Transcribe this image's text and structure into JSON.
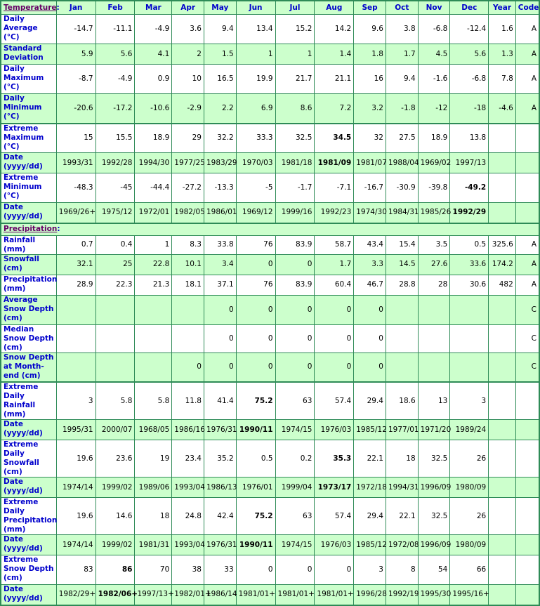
{
  "header": {
    "section_label": "Temperature",
    "columns": [
      "Jan",
      "Feb",
      "Mar",
      "Apr",
      "May",
      "Jun",
      "Jul",
      "Aug",
      "Sep",
      "Oct",
      "Nov",
      "Dec",
      "Year",
      "Code"
    ]
  },
  "temperature": {
    "rows": [
      {
        "label": "Daily Average (°C)",
        "values": [
          "-14.7",
          "-11.1",
          "-4.9",
          "3.6",
          "9.4",
          "13.4",
          "15.2",
          "14.2",
          "9.6",
          "3.8",
          "-6.8",
          "-12.4",
          "1.6",
          "A"
        ],
        "bold": []
      },
      {
        "label": "Standard Deviation",
        "values": [
          "5.9",
          "5.6",
          "4.1",
          "2",
          "1.5",
          "1",
          "1",
          "1.4",
          "1.8",
          "1.7",
          "4.5",
          "5.6",
          "1.3",
          "A"
        ],
        "bold": []
      },
      {
        "label": "Daily Maximum (°C)",
        "values": [
          "-8.7",
          "-4.9",
          "0.9",
          "10",
          "16.5",
          "19.9",
          "21.7",
          "21.1",
          "16",
          "9.4",
          "-1.6",
          "-6.8",
          "7.8",
          "A"
        ],
        "bold": []
      },
      {
        "label": "Daily Minimum (°C)",
        "values": [
          "-20.6",
          "-17.2",
          "-10.6",
          "-2.9",
          "2.2",
          "6.9",
          "8.6",
          "7.2",
          "3.2",
          "-1.8",
          "-12",
          "-18",
          "-4.6",
          "A"
        ],
        "bold": []
      },
      {
        "label": "Extreme Maximum (°C)",
        "values": [
          "15",
          "15.5",
          "18.9",
          "29",
          "32.2",
          "33.3",
          "32.5",
          "34.5",
          "32",
          "27.5",
          "18.9",
          "13.8",
          "",
          ""
        ],
        "bold": [
          7
        ]
      },
      {
        "label": "Date (yyyy/dd)",
        "values": [
          "1993/31",
          "1992/28",
          "1994/30",
          "1977/25",
          "1983/29",
          "1970/03",
          "1981/18",
          "1981/09",
          "1981/07",
          "1988/04",
          "1969/02",
          "1997/13",
          "",
          ""
        ],
        "bold": [
          7
        ]
      },
      {
        "label": "Extreme Minimum (°C)",
        "values": [
          "-48.3",
          "-45",
          "-44.4",
          "-27.2",
          "-13.3",
          "-5",
          "-1.7",
          "-7.1",
          "-16.7",
          "-30.9",
          "-39.8",
          "-49.2",
          "",
          ""
        ],
        "bold": [
          11
        ]
      },
      {
        "label": "Date (yyyy/dd)",
        "values": [
          "1969/26+",
          "1975/12",
          "1972/01",
          "1982/05",
          "1986/01",
          "1969/12",
          "1999/16",
          "1992/23",
          "1974/30",
          "1984/31",
          "1985/26",
          "1992/29",
          "",
          ""
        ],
        "bold": [
          11
        ]
      }
    ]
  },
  "precipitation": {
    "section_label": "Precipitation",
    "rows": [
      {
        "label": "Rainfall (mm)",
        "values": [
          "0.7",
          "0.4",
          "1",
          "8.3",
          "33.8",
          "76",
          "83.9",
          "58.7",
          "43.4",
          "15.4",
          "3.5",
          "0.5",
          "325.6",
          "A"
        ],
        "bold": []
      },
      {
        "label": "Snowfall (cm)",
        "values": [
          "32.1",
          "25",
          "22.8",
          "10.1",
          "3.4",
          "0",
          "0",
          "1.7",
          "3.3",
          "14.5",
          "27.6",
          "33.6",
          "174.2",
          "A"
        ],
        "bold": []
      },
      {
        "label": "Precipitation (mm)",
        "values": [
          "28.9",
          "22.3",
          "21.3",
          "18.1",
          "37.1",
          "76",
          "83.9",
          "60.4",
          "46.7",
          "28.8",
          "28",
          "30.6",
          "482",
          "A"
        ],
        "bold": []
      },
      {
        "label": "Average Snow Depth (cm)",
        "values": [
          "",
          "",
          "",
          "",
          "0",
          "0",
          "0",
          "0",
          "0",
          "",
          "",
          "",
          "",
          "C"
        ],
        "bold": []
      },
      {
        "label": "Median Snow Depth (cm)",
        "values": [
          "",
          "",
          "",
          "",
          "0",
          "0",
          "0",
          "0",
          "0",
          "",
          "",
          "",
          "",
          "C"
        ],
        "bold": []
      },
      {
        "label": "Snow Depth at Month-end (cm)",
        "values": [
          "",
          "",
          "",
          "0",
          "0",
          "0",
          "0",
          "0",
          "0",
          "",
          "",
          "",
          "",
          "C"
        ],
        "bold": []
      },
      {
        "label": "Extreme Daily Rainfall (mm)",
        "values": [
          "3",
          "5.8",
          "5.8",
          "11.8",
          "41.4",
          "75.2",
          "63",
          "57.4",
          "29.4",
          "18.6",
          "13",
          "3",
          "",
          ""
        ],
        "bold": [
          5
        ]
      },
      {
        "label": "Date (yyyy/dd)",
        "values": [
          "1995/31",
          "2000/07",
          "1968/05",
          "1986/16",
          "1976/31",
          "1990/11",
          "1974/15",
          "1976/03",
          "1985/12",
          "1977/01",
          "1971/20",
          "1989/24",
          "",
          ""
        ],
        "bold": [
          5
        ]
      },
      {
        "label": "Extreme Daily Snowfall (cm)",
        "values": [
          "19.6",
          "23.6",
          "19",
          "23.4",
          "35.2",
          "0.5",
          "0.2",
          "35.3",
          "22.1",
          "18",
          "32.5",
          "26",
          "",
          ""
        ],
        "bold": [
          7
        ]
      },
      {
        "label": "Date (yyyy/dd)",
        "values": [
          "1974/14",
          "1999/02",
          "1989/06",
          "1993/04",
          "1986/13",
          "1976/01",
          "1999/04",
          "1973/17",
          "1972/18",
          "1994/31",
          "1996/09",
          "1980/09",
          "",
          ""
        ],
        "bold": [
          7
        ]
      },
      {
        "label": "Extreme Daily Precipitation (mm)",
        "values": [
          "19.6",
          "14.6",
          "18",
          "24.8",
          "42.4",
          "75.2",
          "63",
          "57.4",
          "29.4",
          "22.1",
          "32.5",
          "26",
          "",
          ""
        ],
        "bold": [
          5
        ]
      },
      {
        "label": "Date (yyyy/dd)",
        "values": [
          "1974/14",
          "1999/02",
          "1981/31",
          "1993/04",
          "1976/31",
          "1990/11",
          "1974/15",
          "1976/03",
          "1985/12",
          "1972/08",
          "1996/09",
          "1980/09",
          "",
          ""
        ],
        "bold": [
          5
        ]
      },
      {
        "label": "Extreme Snow Depth (cm)",
        "values": [
          "83",
          "86",
          "70",
          "38",
          "33",
          "0",
          "0",
          "0",
          "3",
          "8",
          "54",
          "66",
          "",
          ""
        ],
        "bold": [
          1
        ]
      },
      {
        "label": "Date (yyyy/dd)",
        "values": [
          "1982/29+",
          "1982/06+",
          "1997/13+",
          "1982/01+",
          "1986/14",
          "1981/01+",
          "1981/01+",
          "1981/01+",
          "1996/28",
          "1992/19",
          "1995/30",
          "1995/16+",
          "",
          ""
        ],
        "bold": [
          1
        ]
      }
    ]
  },
  "colors": {
    "border": "#2e8b57",
    "shaded_row": "#ccffcc",
    "label_text": "#0000cc",
    "section_link": "#660066"
  }
}
